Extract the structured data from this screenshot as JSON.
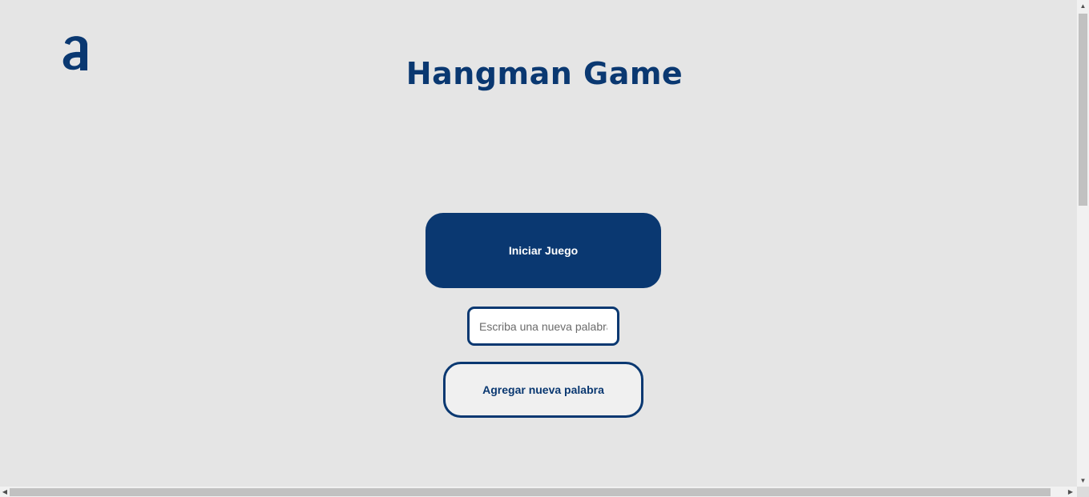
{
  "header": {
    "logo_icon": "alura-a-logo-icon",
    "title": "Hangman Game"
  },
  "main": {
    "start_button_label": "Iniciar Juego",
    "new_word_input": {
      "value": "",
      "placeholder": "Escriba una nueva palabra"
    },
    "add_word_button_label": "Agregar nueva palabra"
  },
  "colors": {
    "primary": "#0a3871",
    "background": "#e5e5e5",
    "button_text_light": "#ffffff",
    "secondary_button_bg": "#f0f0f0"
  }
}
